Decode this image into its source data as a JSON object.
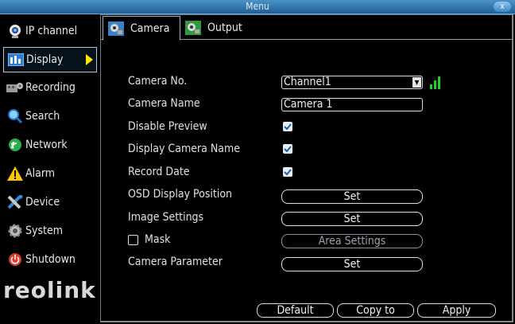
{
  "window": {
    "title": "Menu",
    "close_label": "x"
  },
  "sidebar": {
    "items": [
      {
        "label": "IP channel",
        "icon": "camera-icon"
      },
      {
        "label": "Display",
        "icon": "display-icon"
      },
      {
        "label": "Recording",
        "icon": "recording-icon"
      },
      {
        "label": "Search",
        "icon": "search-icon"
      },
      {
        "label": "Network",
        "icon": "network-icon"
      },
      {
        "label": "Alarm",
        "icon": "alarm-icon"
      },
      {
        "label": "Device",
        "icon": "device-icon"
      },
      {
        "label": "System",
        "icon": "gear-icon"
      },
      {
        "label": "Shutdown",
        "icon": "power-icon"
      }
    ],
    "active": "Display",
    "logo": "reolink"
  },
  "tabs": [
    {
      "label": "Camera"
    },
    {
      "label": "Output"
    }
  ],
  "form": {
    "camera_no_label": "Camera No.",
    "camera_no_value": "Channel1",
    "camera_name_label": "Camera Name",
    "camera_name_value": "Camera 1",
    "disable_preview_label": "Disable Preview",
    "disable_preview_checked": true,
    "display_camera_name_label": "Display Camera Name",
    "display_camera_name_checked": true,
    "record_date_label": "Record Date",
    "record_date_checked": true,
    "osd_label": "OSD Display Position",
    "osd_button": "Set",
    "image_settings_label": "Image Settings",
    "image_settings_button": "Set",
    "mask_label": "Mask",
    "mask_checked": false,
    "area_settings_button": "Area Settings",
    "camera_parameter_label": "Camera Parameter",
    "camera_parameter_button": "Set"
  },
  "footer": {
    "default_label": "Default",
    "copy_to_label": "Copy to",
    "apply_label": "Apply"
  },
  "colors": {
    "titlebar": "#2f78b3",
    "signal": "#1fd12a",
    "arrow": "#ffe600"
  }
}
